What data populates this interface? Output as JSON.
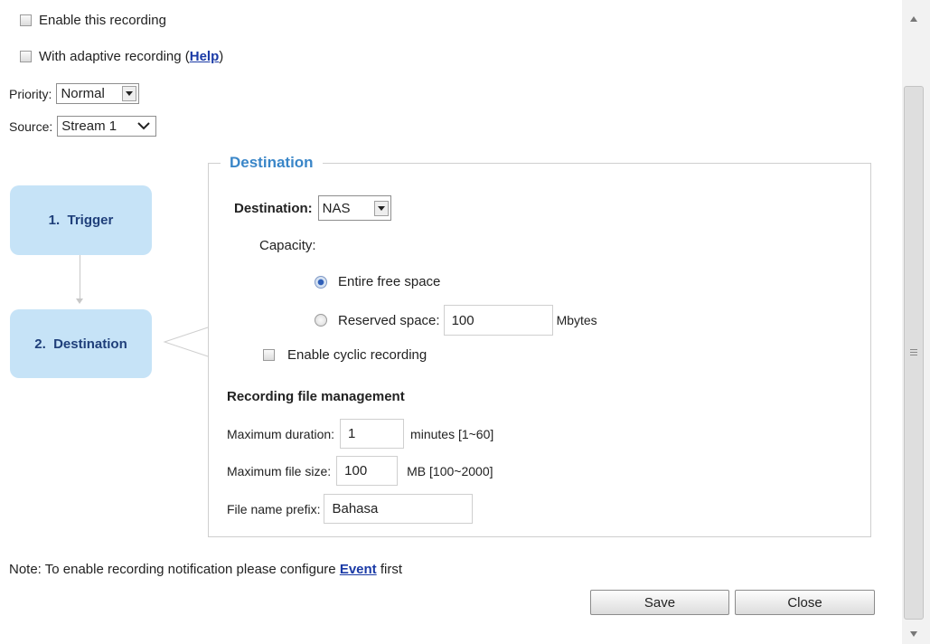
{
  "options": {
    "enable_recording": "Enable this recording",
    "adaptive_recording": "With adaptive recording (",
    "help_link": "Help",
    "adaptive_close": ")"
  },
  "priority": {
    "label": "Priority:",
    "value": "Normal"
  },
  "source": {
    "label": "Source:",
    "value": "Stream 1"
  },
  "steps": [
    {
      "label": "1.  Trigger"
    },
    {
      "label": "2.  Destination"
    }
  ],
  "destination": {
    "legend": "Destination",
    "label": "Destination:",
    "value": "NAS",
    "capacity_label": "Capacity:",
    "entire_free_space": "Entire free space",
    "reserved_space_label": "Reserved space:",
    "reserved_space_value": "100",
    "reserved_unit": "Mbytes",
    "cyclic_label": "Enable cyclic recording"
  },
  "file_management": {
    "heading": "Recording file management",
    "max_duration_label": "Maximum duration:",
    "max_duration_value": "1",
    "max_duration_unit": "minutes [1~60]",
    "max_size_label": "Maximum file size:",
    "max_size_value": "100",
    "max_size_unit": "MB [100~2000]",
    "prefix_label": "File name prefix:",
    "prefix_value": "Bahasa"
  },
  "note": {
    "text": "Note: To enable recording notification please configure",
    "link": "Event",
    "suffix": "first"
  },
  "buttons": {
    "save": "Save",
    "close": "Close"
  },
  "colors": {
    "step_bg": "#c6e3f7",
    "legend": "#3a86c8",
    "link": "#1a3aa6"
  }
}
